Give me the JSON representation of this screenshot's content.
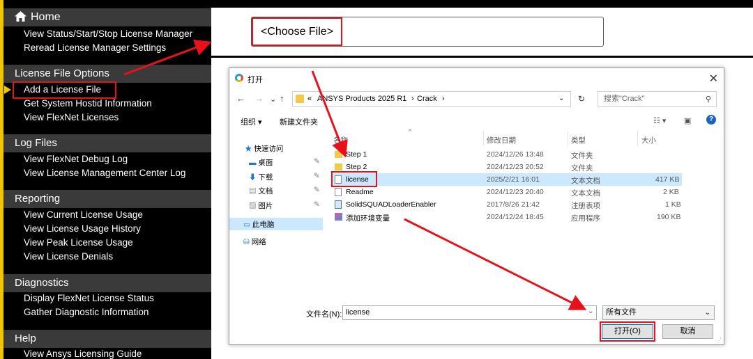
{
  "sidebar": {
    "home": "Home",
    "home_links": [
      "View Status/Start/Stop License Manager",
      "Reread License Manager Settings"
    ],
    "sections": [
      {
        "title": "License File Options",
        "links": [
          "Add a License File",
          "Get System Hostid Information",
          "View FlexNet Licenses"
        ]
      },
      {
        "title": "Log Files",
        "links": [
          "View FlexNet Debug Log",
          "View License Management Center Log"
        ]
      },
      {
        "title": "Reporting",
        "links": [
          "View Current License Usage",
          "View License Usage History",
          "View Peak License Usage",
          "View License Denials"
        ]
      },
      {
        "title": "Diagnostics",
        "links": [
          "Display FlexNet License Status",
          "Gather Diagnostic Information"
        ]
      },
      {
        "title": "Help",
        "links": [
          "View Ansys Licensing Guide"
        ]
      }
    ]
  },
  "main": {
    "choose_file": "<Choose File>"
  },
  "dialog": {
    "title": "打开",
    "close": "✕",
    "nav": {
      "back": "←",
      "forward": "→",
      "down": "⌄",
      "up": "↑"
    },
    "breadcrumbs": [
      "«",
      "ANSYS Products 2025 R1",
      "›",
      "Crack",
      "›"
    ],
    "search_placeholder": "搜索\"Crack\"",
    "toolbar": {
      "organize": "组织 ▾",
      "new_folder": "新建文件夹"
    },
    "nav_pane": [
      {
        "label": "快速访问",
        "icon": "star-icon"
      },
      {
        "label": "桌面",
        "icon": "desktop-icon"
      },
      {
        "label": "下载",
        "icon": "download-icon"
      },
      {
        "label": "文档",
        "icon": "document-icon"
      },
      {
        "label": "图片",
        "icon": "picture-icon"
      },
      {
        "label": "此电脑",
        "icon": "computer-icon"
      },
      {
        "label": "网络",
        "icon": "network-icon"
      }
    ],
    "columns": [
      "名称",
      "修改日期",
      "类型",
      "大小"
    ],
    "files": [
      {
        "name": "Step 1",
        "date": "2024/12/26 13:48",
        "type": "文件夹",
        "size": "",
        "icon": "folder-icon"
      },
      {
        "name": "Step 2",
        "date": "2024/12/23 20:52",
        "type": "文件夹",
        "size": "",
        "icon": "folder-icon"
      },
      {
        "name": "license",
        "date": "2025/2/21 16:01",
        "type": "文本文档",
        "size": "417 KB",
        "icon": "text-file-icon"
      },
      {
        "name": "Readme",
        "date": "2024/12/23 20:40",
        "type": "文本文档",
        "size": "2 KB",
        "icon": "text-file-icon"
      },
      {
        "name": "SolidSQUADLoaderEnabler",
        "date": "2017/8/26 21:42",
        "type": "注册表项",
        "size": "1 KB",
        "icon": "registry-icon"
      },
      {
        "name": "添加环境变量",
        "date": "2024/12/24 18:45",
        "type": "应用程序",
        "size": "190 KB",
        "icon": "app-icon"
      }
    ],
    "filename_label": "文件名(N):",
    "filename_value": "license",
    "filetype": "所有文件",
    "open": "打开(O)",
    "cancel": "取消"
  },
  "colors": {
    "highlight": "#e8101a",
    "accent": "#f0c400",
    "selected_row": "#cce8ff"
  }
}
